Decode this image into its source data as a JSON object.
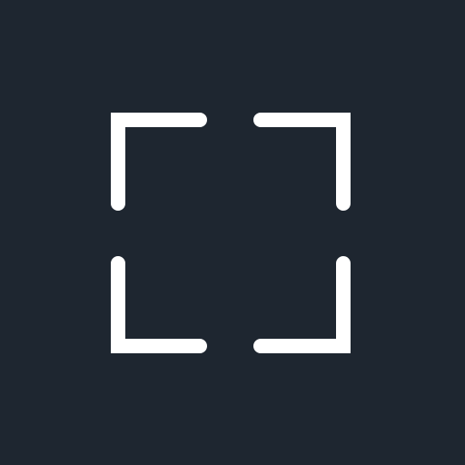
{
  "app": {
    "icon": "fullscreen-icon",
    "background_color": "#1e2630",
    "icon_color": "#ffffff"
  }
}
